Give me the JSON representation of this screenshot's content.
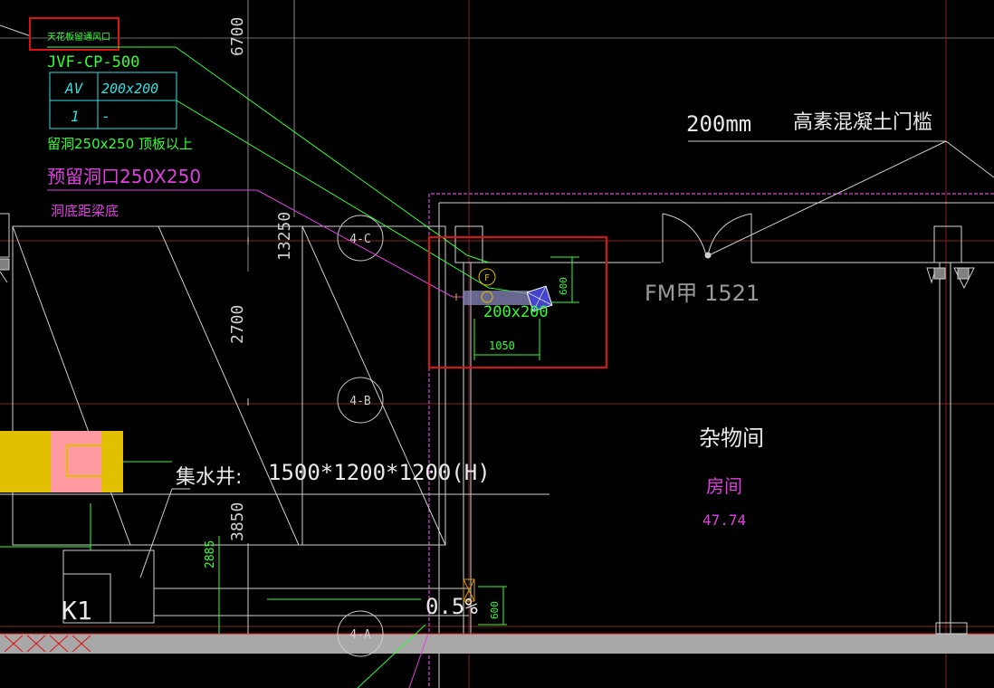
{
  "colors": {
    "background": "#000000",
    "white": "#e8e8e8",
    "grey": "#9a9a9a",
    "green": "#33ff33",
    "cyan": "#33e0e0",
    "magenta": "#e040e0",
    "red": "#e01010",
    "yellow": "#e0c000",
    "pink": "#ff9aa0",
    "hatch": "#b0b0b0"
  },
  "labels": {
    "top_note": "天花板留通风口",
    "equipment_code": "JVF-CP-500",
    "table": {
      "r1c1": "AV",
      "r1c2": "200x200",
      "r2c1": "1",
      "r2c2": "-"
    },
    "note_green": "留洞250x250  顶板以上",
    "note_magenta_1": "预留洞口250X250",
    "note_magenta_2": "洞底距梁底",
    "threshold": "200mm",
    "threshold_desc": "高素混凝土门槛",
    "door_code": "FM甲 1521",
    "duct_size": "200x200",
    "dim_1050": "1050",
    "dim_600_top": "600",
    "dim_600_bottom": "600",
    "room_name": "杂物间",
    "room_type": "房间",
    "room_area": "47.74",
    "sump_label": "集水井:",
    "sump_size": "1500*1200*1200(H)",
    "slope": "0.5%",
    "k1": "K1",
    "axis_4c": "4-C",
    "axis_4b": "4-B",
    "axis_4a": "4-A",
    "dim_6700": "6700",
    "dim_13250": "13250",
    "dim_2700": "2700",
    "dim_3850": "3850",
    "dim_2885": "2885",
    "f_marker": "F"
  }
}
